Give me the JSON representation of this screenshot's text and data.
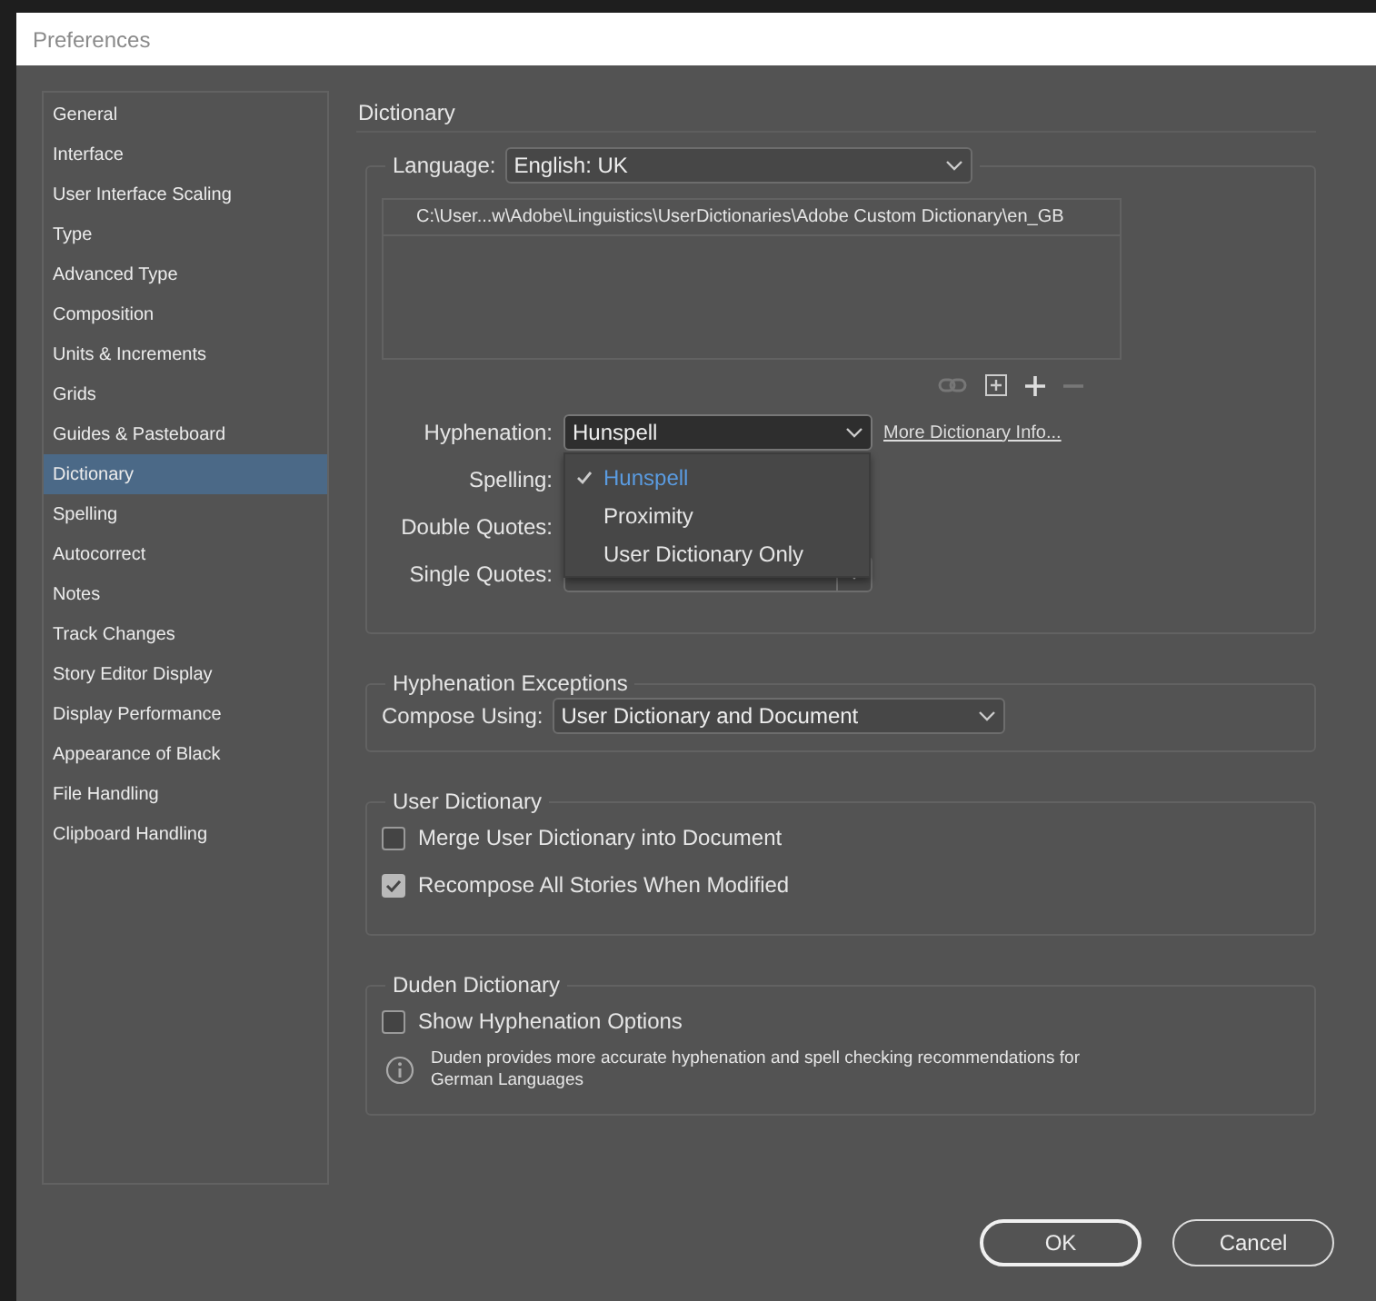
{
  "window": {
    "title": "Preferences"
  },
  "sidebar": {
    "items": [
      {
        "label": "General",
        "selected": false
      },
      {
        "label": "Interface",
        "selected": false
      },
      {
        "label": "User Interface Scaling",
        "selected": false
      },
      {
        "label": "Type",
        "selected": false
      },
      {
        "label": "Advanced Type",
        "selected": false
      },
      {
        "label": "Composition",
        "selected": false
      },
      {
        "label": "Units & Increments",
        "selected": false
      },
      {
        "label": "Grids",
        "selected": false
      },
      {
        "label": "Guides & Pasteboard",
        "selected": false
      },
      {
        "label": "Dictionary",
        "selected": true
      },
      {
        "label": "Spelling",
        "selected": false
      },
      {
        "label": "Autocorrect",
        "selected": false
      },
      {
        "label": "Notes",
        "selected": false
      },
      {
        "label": "Track Changes",
        "selected": false
      },
      {
        "label": "Story Editor Display",
        "selected": false
      },
      {
        "label": "Display Performance",
        "selected": false
      },
      {
        "label": "Appearance of Black",
        "selected": false
      },
      {
        "label": "File Handling",
        "selected": false
      },
      {
        "label": "Clipboard Handling",
        "selected": false
      }
    ]
  },
  "panel": {
    "heading": "Dictionary"
  },
  "language_group": {
    "label": "Language:",
    "value": "English: UK",
    "paths": [
      "C:\\User...w\\Adobe\\Linguistics\\UserDictionaries\\Adobe Custom Dictionary\\en_GB"
    ],
    "fields": [
      {
        "label": "Hyphenation:",
        "kind": "dropdown",
        "value": "Hunspell",
        "open": true
      },
      {
        "label": "Spelling:",
        "kind": "covered"
      },
      {
        "label": "Double Quotes:",
        "kind": "covered"
      },
      {
        "label": "Single Quotes:",
        "kind": "dropdown",
        "open": false
      }
    ],
    "link": "More Dictionary Info...",
    "menu_options": [
      {
        "label": "Hunspell",
        "selected": true
      },
      {
        "label": "Proximity",
        "selected": false
      },
      {
        "label": "User Dictionary Only",
        "selected": false
      }
    ]
  },
  "hyphenation_exceptions": {
    "title": "Hyphenation Exceptions",
    "label": "Compose Using:",
    "value": "User Dictionary and Document"
  },
  "user_dictionary": {
    "title": "User Dictionary",
    "options": [
      {
        "label": "Merge User Dictionary into Document",
        "checked": false
      },
      {
        "label": "Recompose All Stories When Modified",
        "checked": true
      }
    ]
  },
  "duden_dictionary": {
    "title": "Duden Dictionary",
    "options": [
      {
        "label": "Show Hyphenation Options",
        "checked": false
      }
    ],
    "note": "Duden provides more accurate hyphenation and spell checking recommendations for German Languages"
  },
  "buttons": [
    {
      "label": "OK",
      "default": true
    },
    {
      "label": "Cancel",
      "default": false
    }
  ]
}
